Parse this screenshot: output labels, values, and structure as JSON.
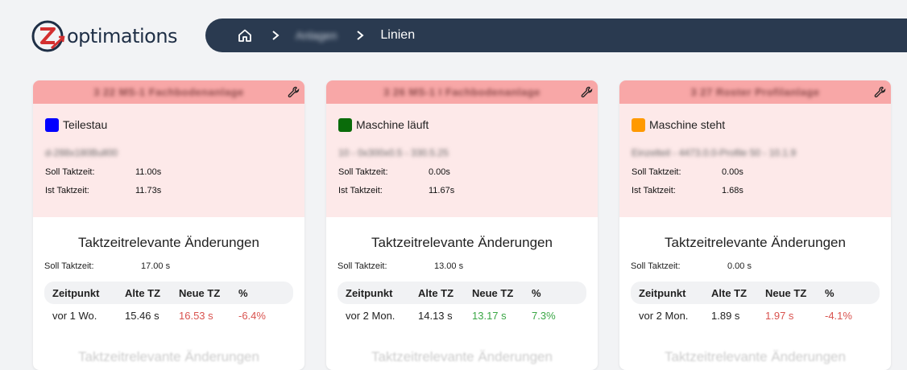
{
  "brand": {
    "logo_letter": "Z",
    "name": "optimations"
  },
  "breadcrumb": {
    "middle": "Anlagen",
    "current": "Linien"
  },
  "labels": {
    "soll_taktzeit": "Soll Taktzeit:",
    "ist_taktzeit": "Ist Taktzeit:",
    "section_title": "Taktzeitrelevante Änderungen",
    "col_zeitpunkt": "Zeitpunkt",
    "col_alte": "Alte TZ",
    "col_neue": "Neue TZ",
    "col_pct": "%"
  },
  "colors": {
    "header_red": "#f8a7a7",
    "status_bg": "#fde9e9",
    "navy": "#2a3a50"
  },
  "cards": [
    {
      "title": "3 22 MS-1 Fachbodenanlage",
      "status": {
        "label": "Teilestau",
        "color": "#0000ff"
      },
      "article": "d-288x180Bull00",
      "soll": "11.00s",
      "ist": "11.73s",
      "change_soll": "17.00 s",
      "rows": [
        {
          "zeitpunkt": "vor 1 Wo.",
          "alte": "15.46 s",
          "neue": "16.53 s",
          "pct": "-6.4%",
          "trend": "red"
        }
      ]
    },
    {
      "title": "3 26 MS-1 I Fachbodenanlage",
      "status": {
        "label": "Maschine läuft",
        "color": "#0a6b0a"
      },
      "article": "10 - 0x300x0.5 - 330.5.25",
      "soll": "0.00s",
      "ist": "11.67s",
      "change_soll": "13.00 s",
      "rows": [
        {
          "zeitpunkt": "vor 2 Mon.",
          "alte": "14.13 s",
          "neue": "13.17 s",
          "pct": "7.3%",
          "trend": "green"
        }
      ]
    },
    {
      "title": "3 27 Roster Profilanlage",
      "status": {
        "label": "Maschine steht",
        "color": "#ff9900"
      },
      "article": "Einzelteil - 4473.0.0-Profile 50 - 10.1.9",
      "soll": "0.00s",
      "ist": "1.68s",
      "change_soll": "0.00 s",
      "rows": [
        {
          "zeitpunkt": "vor 2 Mon.",
          "alte": "1.89 s",
          "neue": "1.97 s",
          "pct": "-4.1%",
          "trend": "red"
        }
      ]
    }
  ]
}
